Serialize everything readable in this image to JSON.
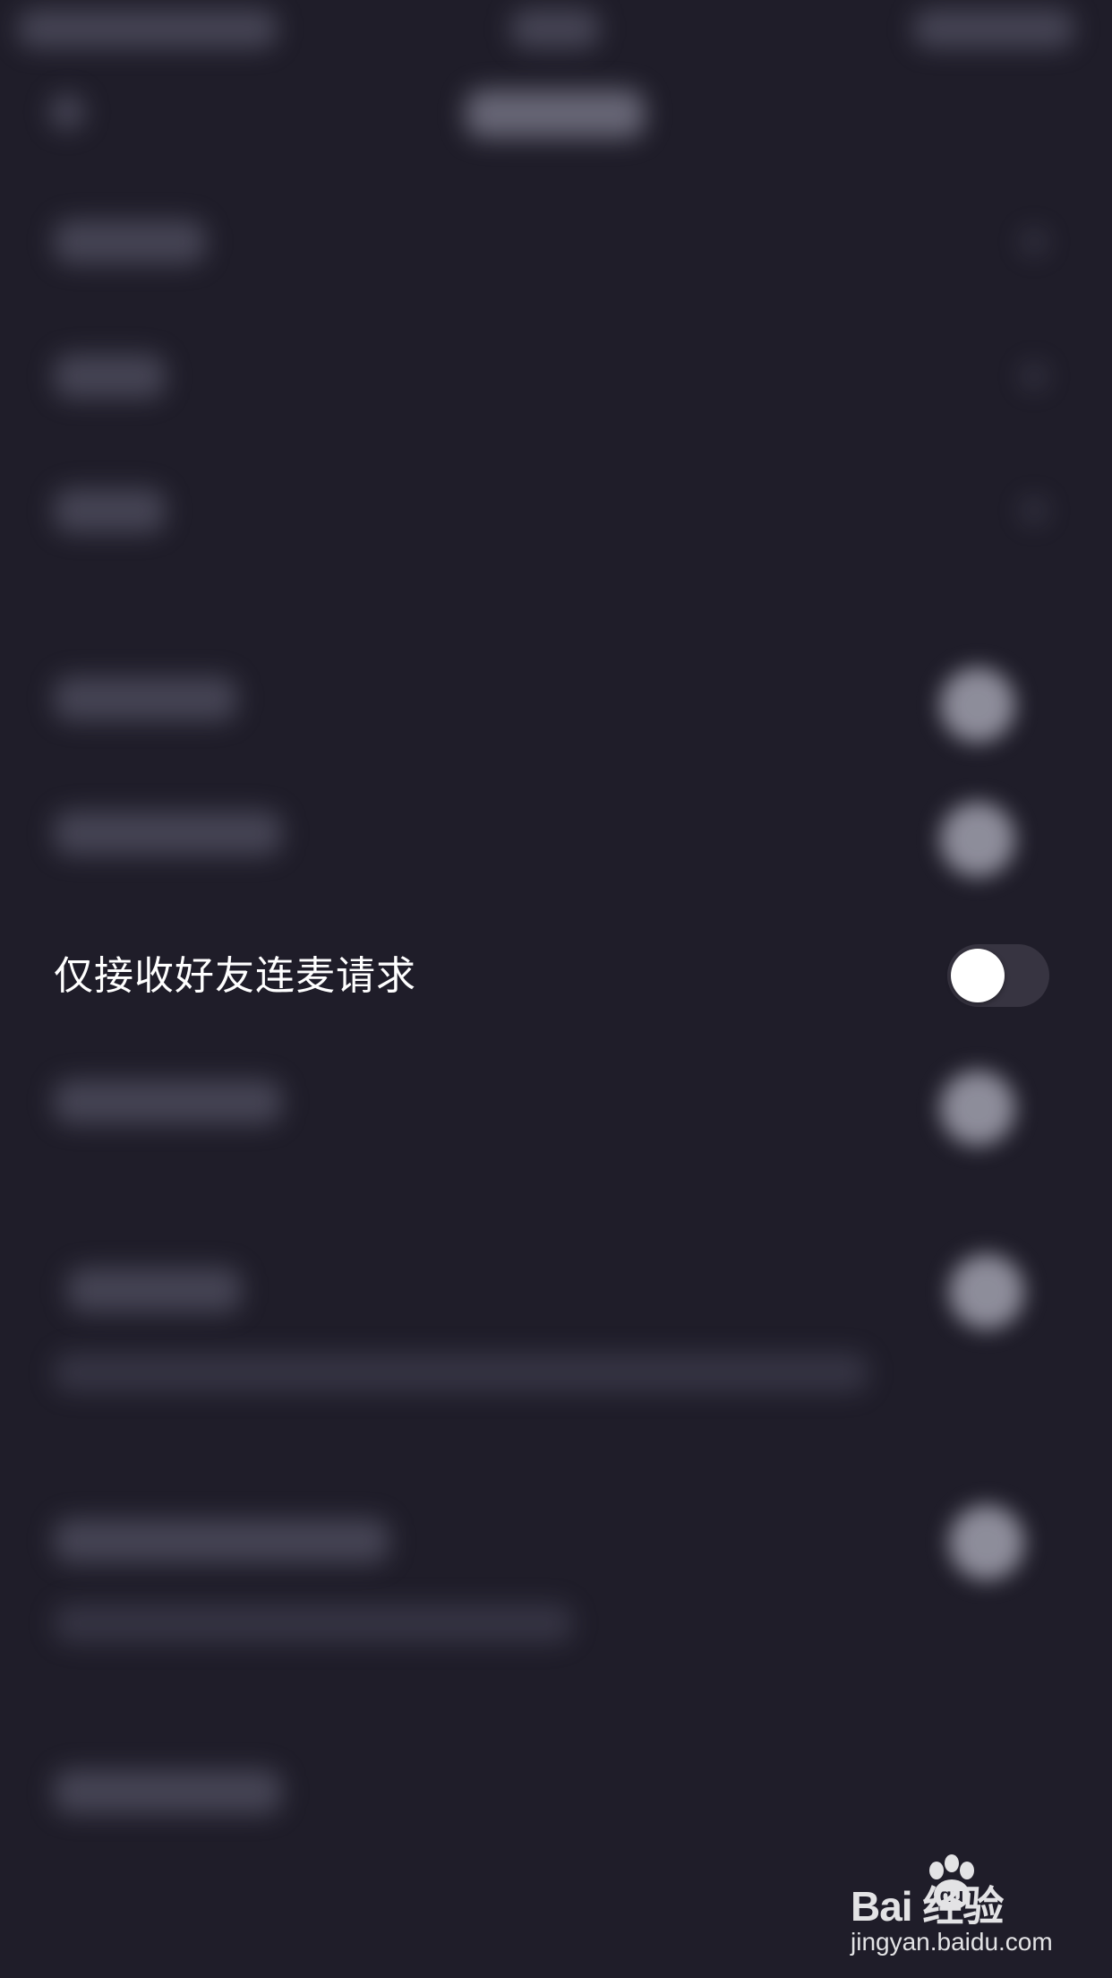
{
  "setting_row": {
    "label": "仅接收好友连麦请求",
    "toggle_on": false
  },
  "watermark": {
    "brand": "Bai  经验",
    "url": "jingyan.baidu.com"
  },
  "colors": {
    "background": "#1f1d29",
    "toggle_track": "#373441",
    "toggle_knob": "#ffffff",
    "text": "#ffffff"
  }
}
